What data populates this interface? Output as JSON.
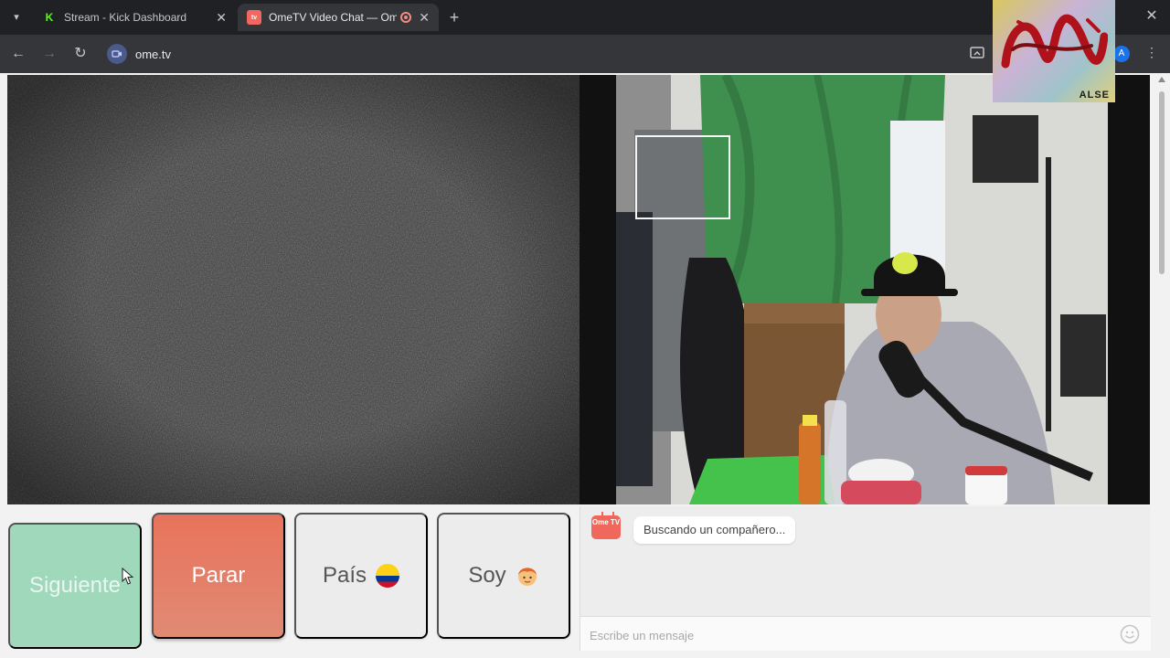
{
  "browser": {
    "tabs": [
      {
        "title": "Stream - Kick Dashboard",
        "active": false
      },
      {
        "title": "OmeTV Video Chat — Ome",
        "active": true,
        "recording": true
      }
    ],
    "favicons": {
      "kick": "K",
      "ome": "tv"
    },
    "new_tab_label": "+",
    "close_label": "✕",
    "url": "ome.tv",
    "profile_initial": "A"
  },
  "overlay": {
    "signature": "ALSE"
  },
  "controls": {
    "next_label": "Siguiente",
    "stop_label": "Parar",
    "country_label": "País",
    "gender_label": "Soy",
    "country_flag": "colombia"
  },
  "chat": {
    "logo_text": "Ome TV",
    "status_message": "Buscando un compañero...",
    "input_placeholder": "Escribe un mensaje"
  },
  "colors": {
    "next": "#9fd8bb",
    "stop": "#e9735c",
    "accent": "#f0675b"
  }
}
